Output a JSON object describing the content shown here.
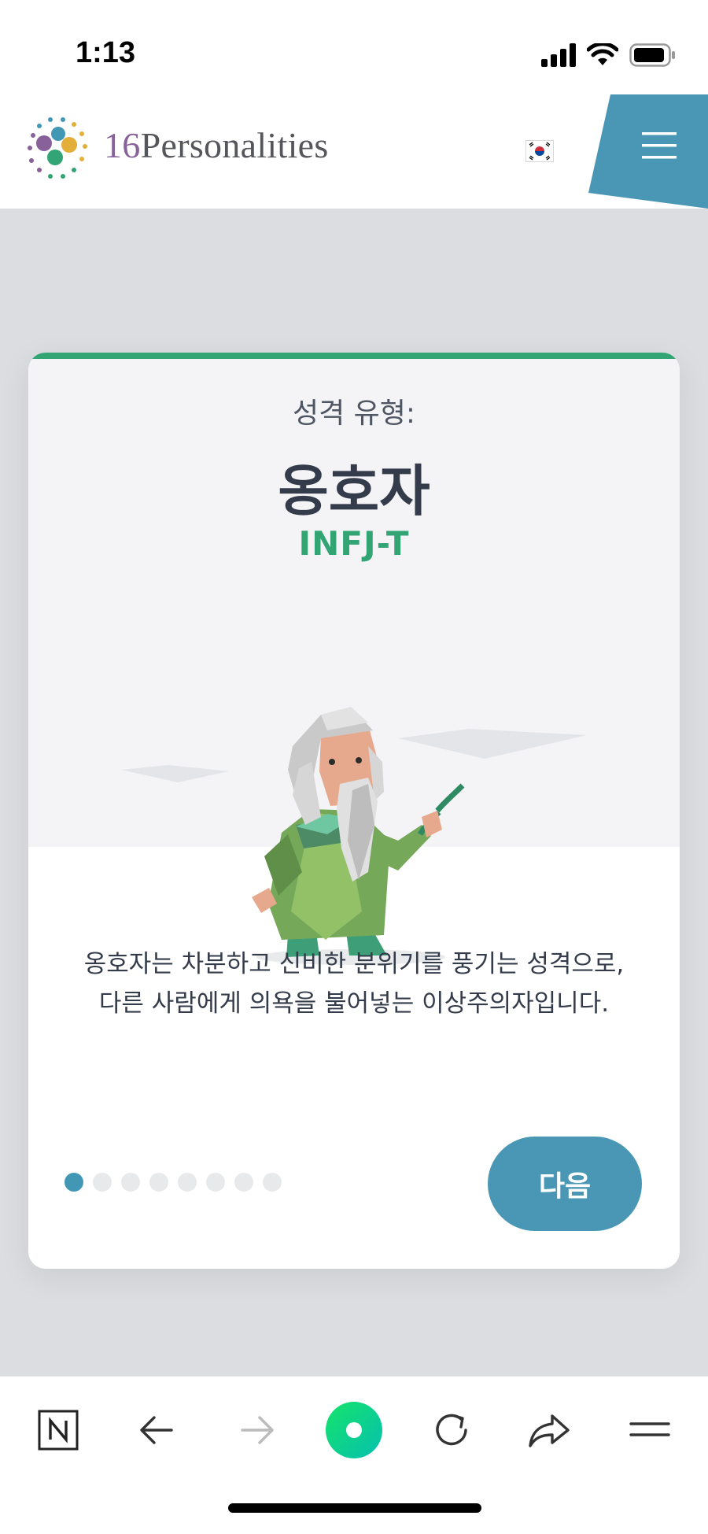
{
  "status_bar": {
    "time": "1:13",
    "icons": [
      "signal-icon",
      "wifi-icon",
      "battery-icon"
    ]
  },
  "header": {
    "logo_number": "16",
    "logo_word": "Personalities",
    "flag_icon": "korea-flag-icon",
    "menu_icon": "hamburger-menu-icon",
    "menu_color": "#4a97b5"
  },
  "card": {
    "accent_color": "#33a474",
    "type_label": "성격 유형:",
    "type_name": "옹호자",
    "type_code": "INFJ-T",
    "description_line1": "옹호자는 차분하고 신비한 분위기를 풍기는 성격으로,",
    "description_line2": "다른 사람에게 의욕을 불어넣는 이상주의자입니다.",
    "pager": {
      "total": 8,
      "current": 1
    },
    "next_label": "다음",
    "next_color": "#4a97b5"
  },
  "browser_toolbar": {
    "buttons": [
      "naver-icon",
      "back-arrow-icon",
      "forward-arrow-icon",
      "home-circle-icon",
      "reload-icon",
      "share-icon",
      "menu-icon"
    ]
  }
}
